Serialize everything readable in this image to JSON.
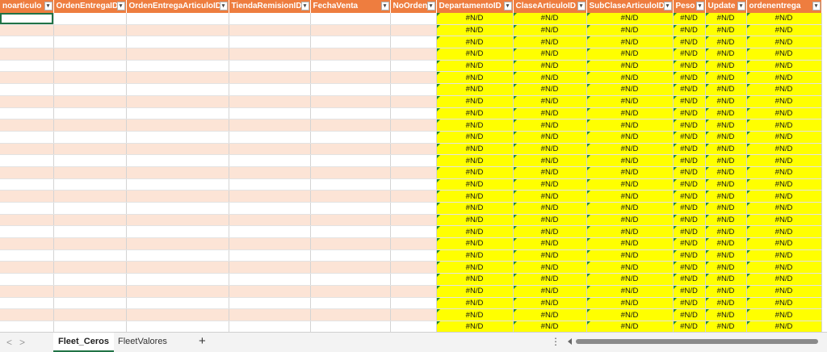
{
  "sheet": {
    "columns": [
      "noarticulo",
      "OrdenEntregaID",
      "OrdenEntregaArticuloID",
      "TiendaRemisionID",
      "FechaVenta",
      "NoOrden",
      "DepartamentoID",
      "ClaseArticuloID",
      "SubClaseArticuloID",
      "Peso",
      "Update",
      "ordenentrega"
    ],
    "filter_glyph": "▾",
    "na_value": "#N/D",
    "row_count": 27,
    "colors": {
      "header": "#ee7d3f",
      "band": "#fce4d6",
      "highlight": "#ffff00",
      "accent": "#217346"
    }
  },
  "tabs": [
    "Fleet_Ceros",
    "FleetValores"
  ],
  "active_tab": "Fleet_Ceros",
  "nav": {
    "prev": "<",
    "next": ">",
    "add": "+",
    "menu": "⋮"
  }
}
